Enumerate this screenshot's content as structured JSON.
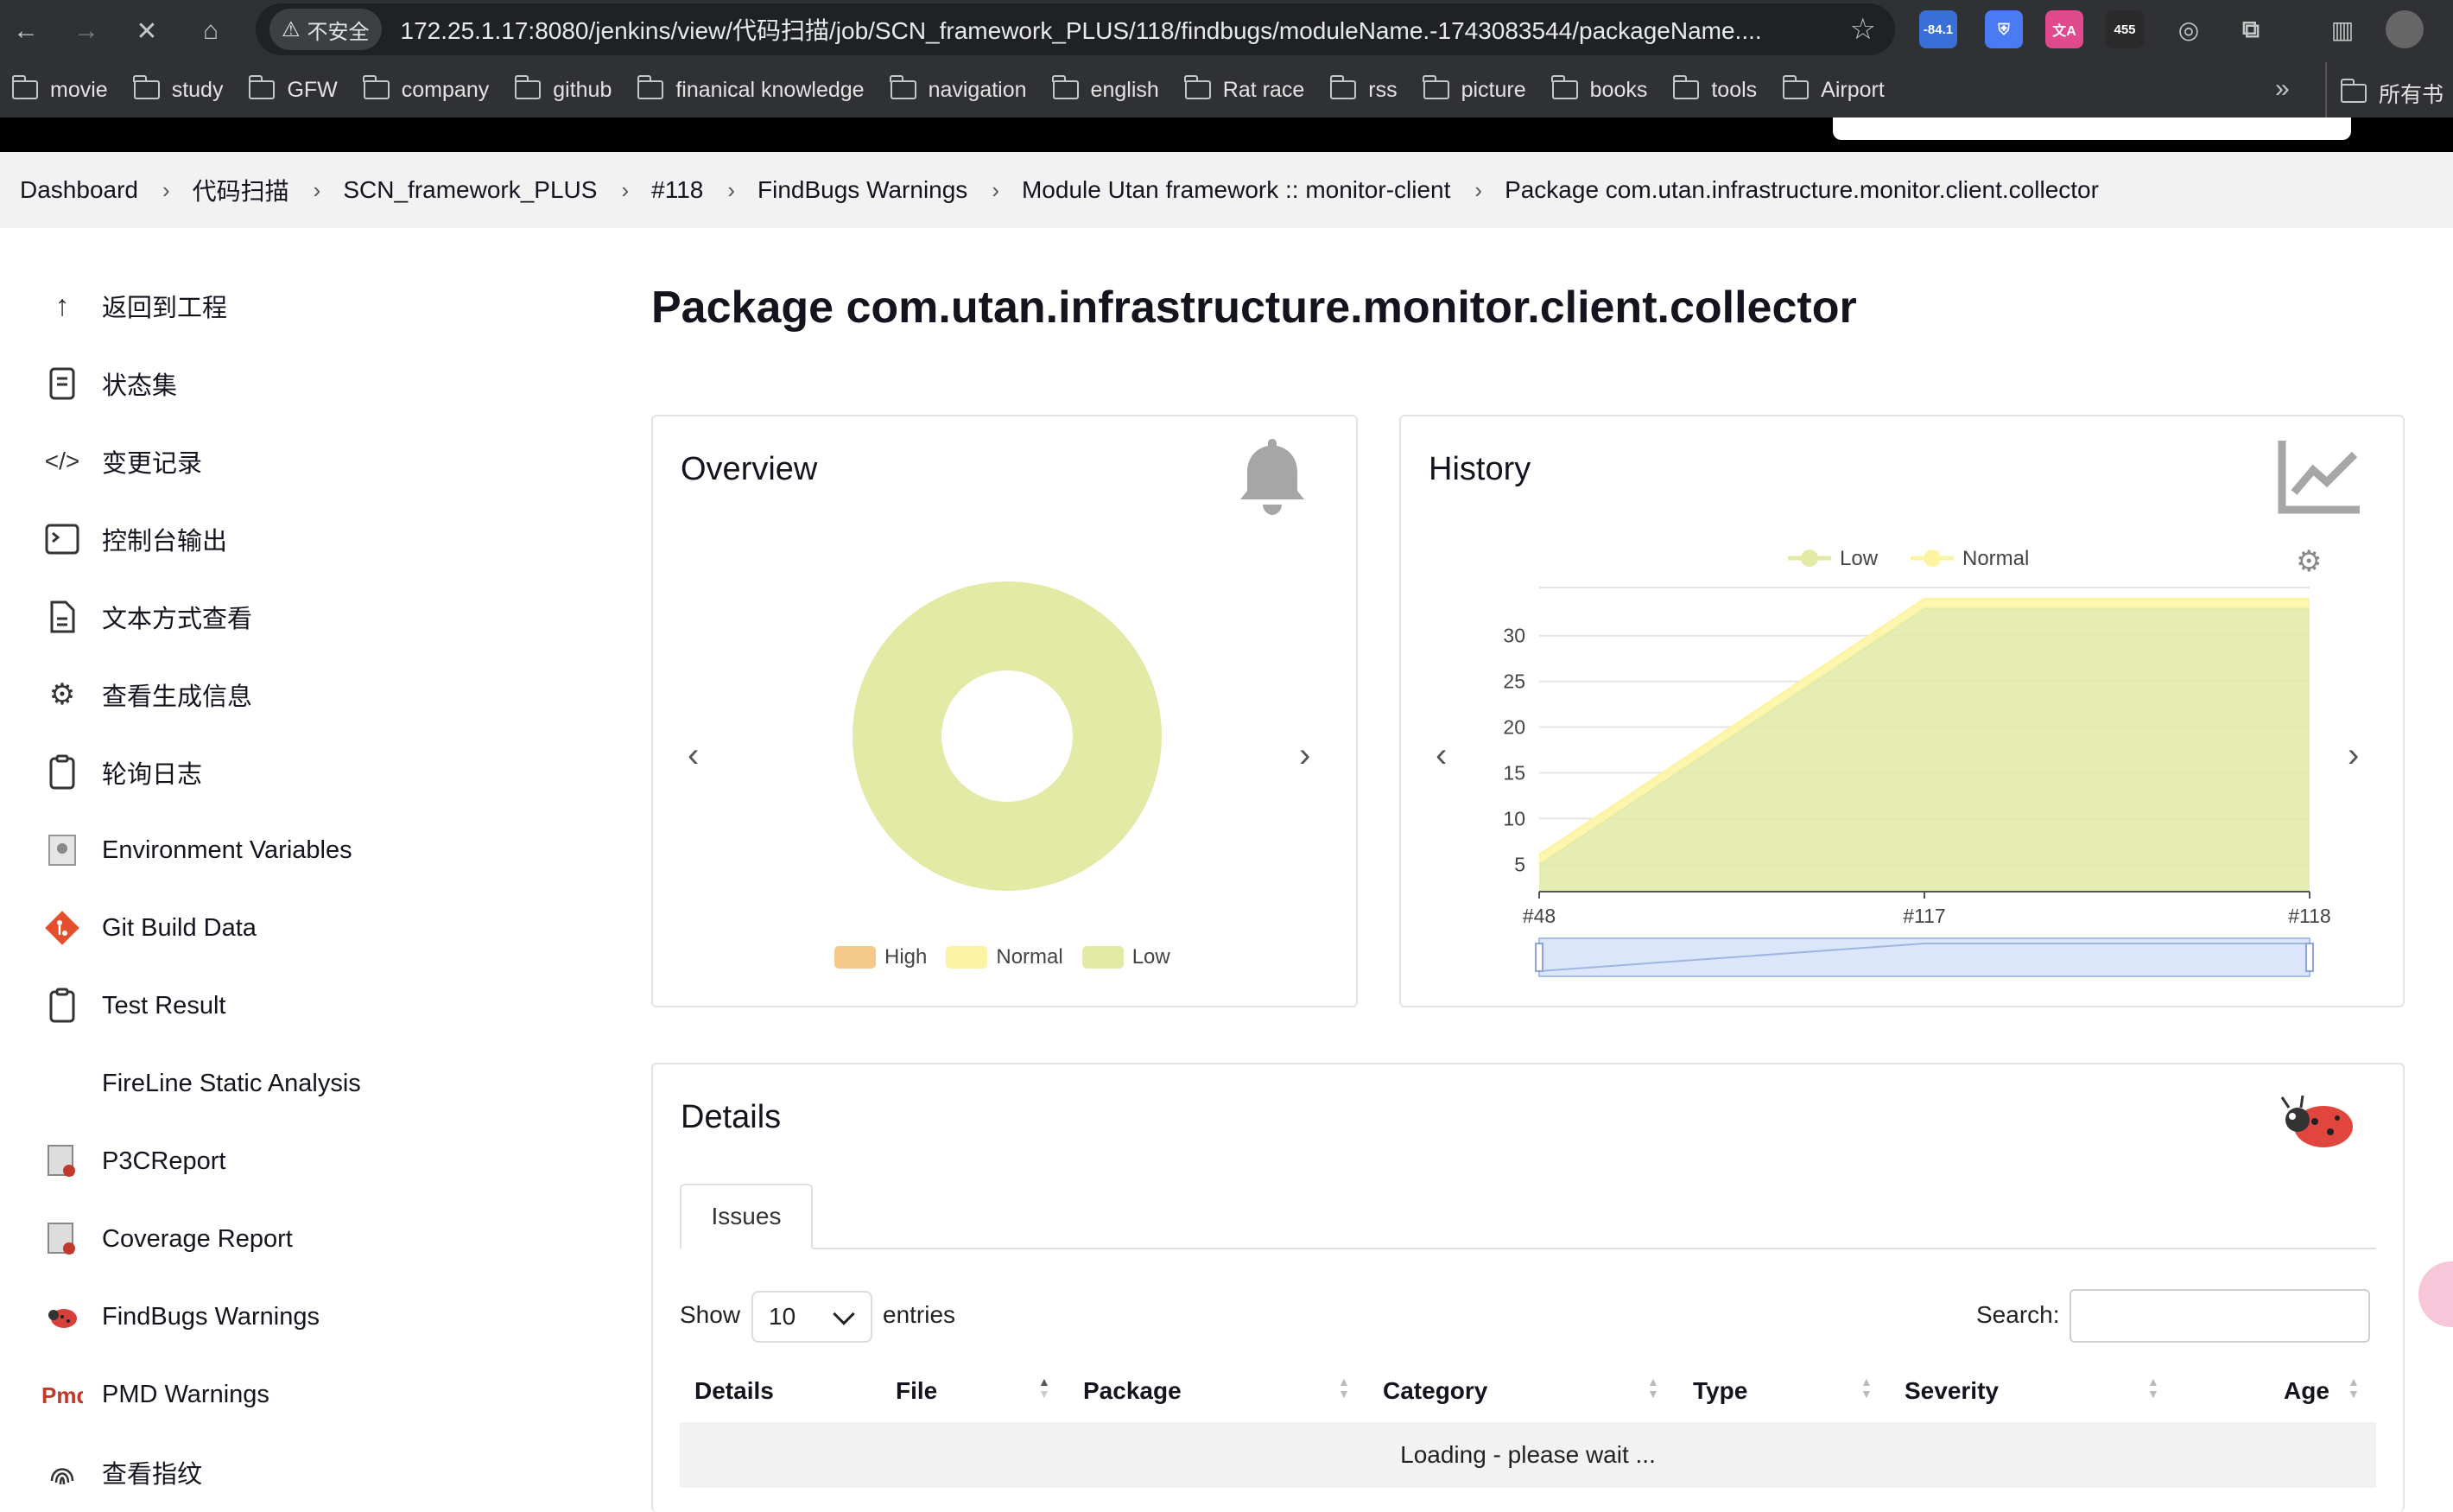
{
  "browser": {
    "security_label": "不安全",
    "url": "172.25.1.17:8080/jenkins/view/代码扫描/job/SCN_framework_PLUS/118/findbugs/moduleName.-1743083544/packageName....",
    "ext_badge_1": "-84.1",
    "ext_badge_2": "455",
    "bookmarks": [
      "movie",
      "study",
      "GFW",
      "company",
      "github",
      "finanical knowledge",
      "navigation",
      "english",
      "Rat race",
      "rss",
      "picture",
      "books",
      "tools",
      "Airport"
    ],
    "bookmarks_more": "»",
    "bookmarks_all": "所有书"
  },
  "breadcrumb": [
    "Dashboard",
    "代码扫描",
    "SCN_framework_PLUS",
    "#118",
    "FindBugs Warnings",
    "Module Utan framework :: monitor-client",
    "Package com.utan.infrastructure.monitor.client.collector"
  ],
  "sidebar": [
    {
      "label": "返回到工程",
      "icon": "arrow-up-icon"
    },
    {
      "label": "状态集",
      "icon": "document-icon"
    },
    {
      "label": "变更记录",
      "icon": "code-icon"
    },
    {
      "label": "控制台输出",
      "icon": "terminal-icon"
    },
    {
      "label": "文本方式查看",
      "icon": "text-file-icon"
    },
    {
      "label": "查看生成信息",
      "icon": "gear-icon"
    },
    {
      "label": "轮询日志",
      "icon": "clipboard-icon"
    },
    {
      "label": "Environment Variables",
      "icon": "env-vars-icon"
    },
    {
      "label": "Git Build Data",
      "icon": "git-icon"
    },
    {
      "label": "Test Result",
      "icon": "clipboard-icon"
    },
    {
      "label": "FireLine Static Analysis",
      "icon": ""
    },
    {
      "label": "P3CReport",
      "icon": "report-icon"
    },
    {
      "label": "Coverage Report",
      "icon": "report-icon"
    },
    {
      "label": "FindBugs Warnings",
      "icon": "bug-icon"
    },
    {
      "label": "PMD Warnings",
      "icon": "pmd-icon"
    },
    {
      "label": "查看指纹",
      "icon": "fingerprint-icon"
    }
  ],
  "page": {
    "title": "Package com.utan.infrastructure.monitor.client.collector"
  },
  "overview": {
    "title": "Overview",
    "icon": "bell-icon",
    "legend": [
      {
        "label": "High",
        "color": "#f5c98a"
      },
      {
        "label": "Normal",
        "color": "#fcf4a3"
      },
      {
        "label": "Low",
        "color": "#e2eaa5"
      }
    ]
  },
  "history": {
    "title": "History",
    "icon": "line-chart-icon",
    "settings_icon": "gear-icon"
  },
  "chart_data": [
    {
      "type": "pie",
      "title": "Overview",
      "categories": [
        "High",
        "Normal",
        "Low"
      ],
      "values": [
        0,
        0,
        1
      ],
      "colors": [
        "#f5c98a",
        "#fcf4a3",
        "#e2eaa5"
      ],
      "legend": "bottom"
    },
    {
      "type": "area",
      "title": "History",
      "x": [
        "#48",
        "#117",
        "#118"
      ],
      "series": [
        {
          "name": "Low",
          "values": [
            3,
            31,
            31
          ],
          "color": "#e2eaa5"
        },
        {
          "name": "Normal",
          "values": [
            1,
            1,
            1
          ],
          "color": "#fcf4a3"
        }
      ],
      "stacked": true,
      "ylim": [
        2,
        33
      ],
      "yticks": [
        5,
        10,
        15,
        20,
        25,
        30
      ],
      "legend": "top"
    }
  ],
  "details": {
    "title": "Details",
    "icon": "ladybug-icon",
    "tab_label": "Issues",
    "show_label": "Show",
    "entries_value": "10",
    "entries_label": "entries",
    "search_label": "Search:",
    "columns": [
      "Details",
      "File",
      "Package",
      "Category",
      "Type",
      "Severity",
      "Age"
    ],
    "loading_text": "Loading - please wait ..."
  }
}
